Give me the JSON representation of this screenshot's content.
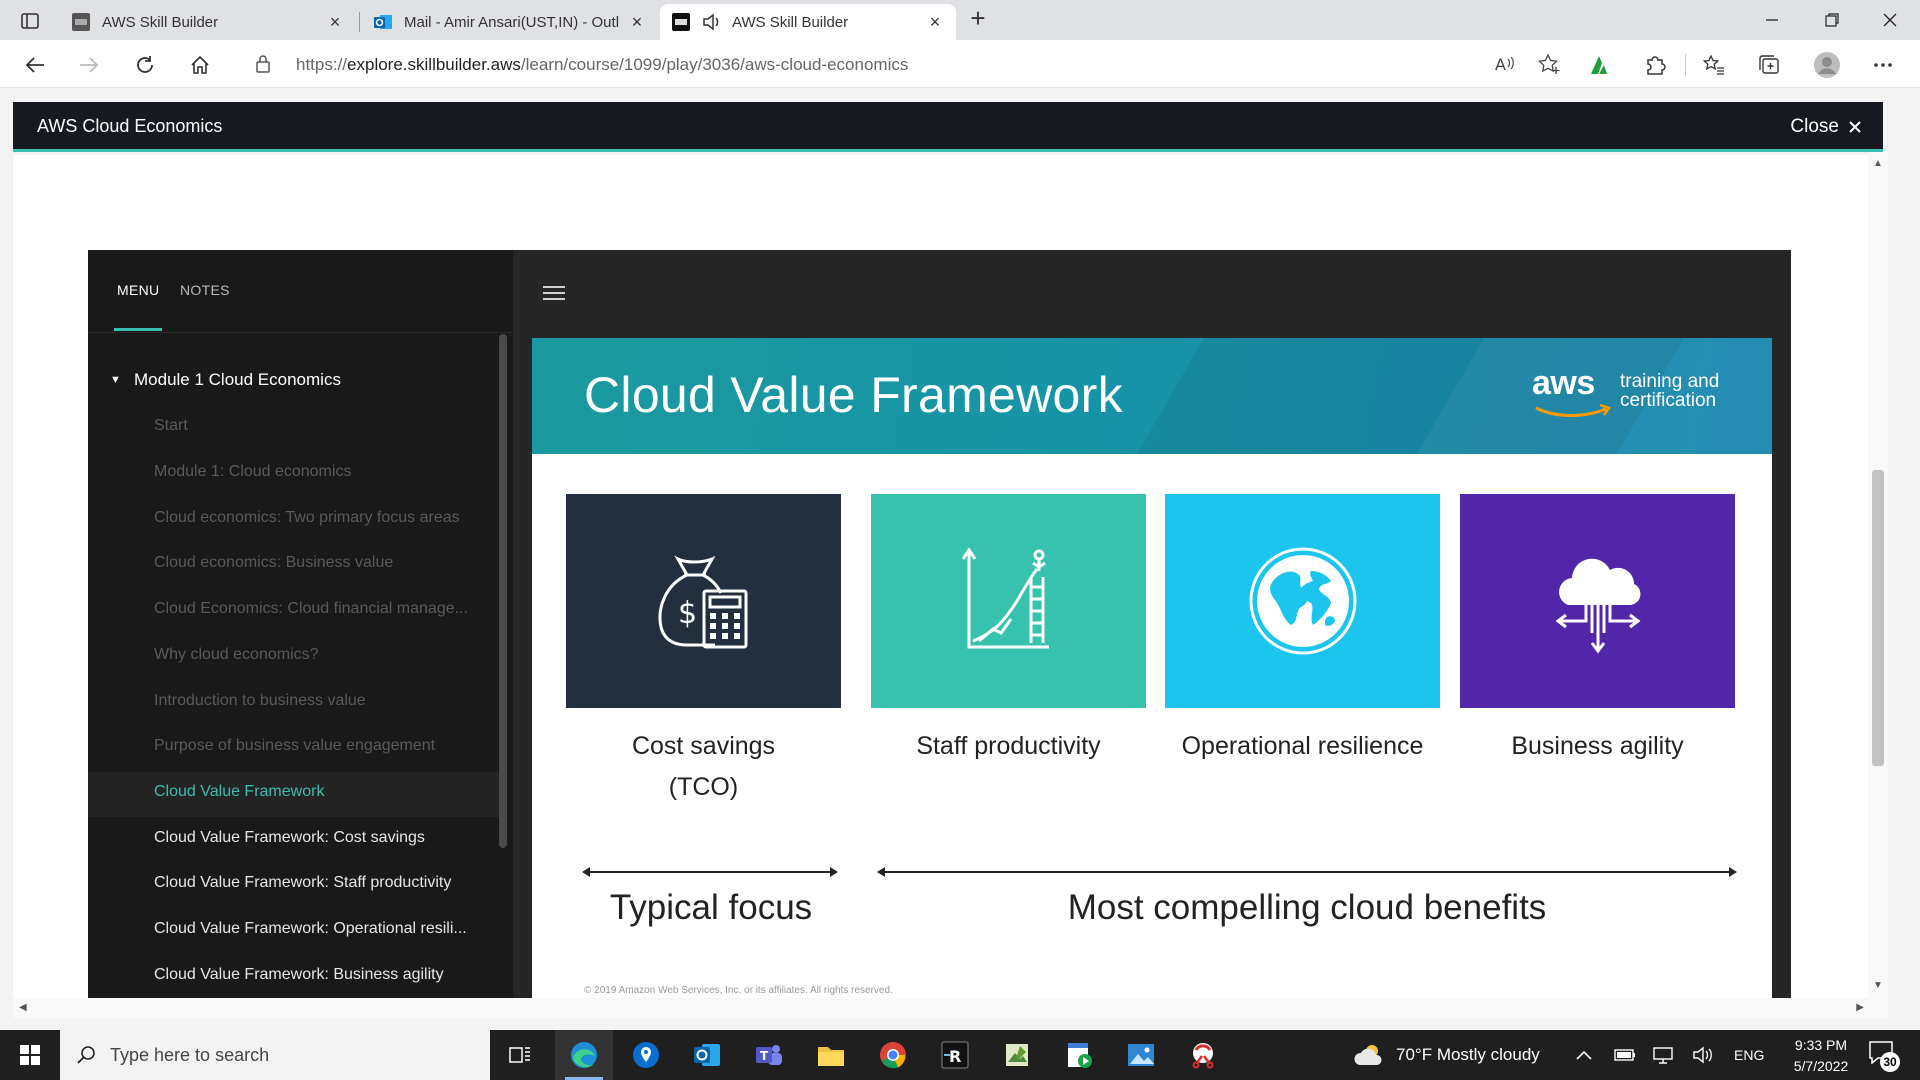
{
  "browser": {
    "tabs": [
      {
        "title": "AWS Skill Builder",
        "favicon": "aws-favicon-icon",
        "active": false
      },
      {
        "title": "Mail - Amir Ansari(UST,IN) - Outl",
        "favicon": "outlook-icon",
        "active": false
      },
      {
        "title": "AWS Skill Builder",
        "favicon": "aws-favicon-icon",
        "active": true,
        "audio": true
      }
    ],
    "url_prefix": "https://",
    "url_host": "explore.skillbuilder.aws",
    "url_path": "/learn/course/1099/play/3036/aws-cloud-economics"
  },
  "page": {
    "header_title": "AWS Cloud Economics",
    "close_label": "Close"
  },
  "sidebar": {
    "tabs": [
      "MENU",
      "NOTES"
    ],
    "module_title": "Module 1 Cloud Economics",
    "lessons": [
      {
        "label": "Start",
        "state": "locked"
      },
      {
        "label": "Module 1: Cloud economics",
        "state": "locked"
      },
      {
        "label": "Cloud economics: Two primary focus areas",
        "state": "locked"
      },
      {
        "label": "Cloud economics: Business value",
        "state": "locked"
      },
      {
        "label": "Cloud Economics: Cloud financial manage...",
        "state": "locked"
      },
      {
        "label": "Why cloud economics?",
        "state": "locked"
      },
      {
        "label": "Introduction to business value",
        "state": "locked"
      },
      {
        "label": "Purpose of business value engagement",
        "state": "locked"
      },
      {
        "label": "Cloud Value Framework",
        "state": "current"
      },
      {
        "label": "Cloud Value Framework: Cost savings",
        "state": "unlocked"
      },
      {
        "label": "Cloud Value Framework: Staff productivity",
        "state": "unlocked"
      },
      {
        "label": "Cloud Value Framework: Operational resili...",
        "state": "unlocked"
      },
      {
        "label": "Cloud Value Framework: Business agility",
        "state": "unlocked"
      }
    ]
  },
  "slide": {
    "title": "Cloud Value Framework",
    "logo_word": "aws",
    "logo_tagline": "training and certification",
    "tiles": [
      {
        "label_line1": "Cost savings",
        "label_line2": "(TCO)",
        "color": "#232f3e",
        "icon": "money-bag-calculator-icon"
      },
      {
        "label_line1": "Staff productivity",
        "label_line2": "",
        "color": "#37c2ae",
        "icon": "growth-chart-ladder-icon"
      },
      {
        "label_line1": "Operational resilience",
        "label_line2": "",
        "color": "#1bc5ee",
        "icon": "globe-icon"
      },
      {
        "label_line1": "Business agility",
        "label_line2": "",
        "color": "#5126a9",
        "icon": "cloud-arrows-icon"
      }
    ],
    "focus_left": "Typical focus",
    "focus_right": "Most compelling cloud benefits",
    "copyright": "© 2019 Amazon Web Services, Inc. or its affiliates. All rights reserved."
  },
  "taskbar": {
    "search_placeholder": "Type here to search",
    "weather": "70°F  Mostly cloudy",
    "language": "ENG",
    "time": "9:33 PM",
    "date": "5/7/2022",
    "notifications": "30"
  }
}
